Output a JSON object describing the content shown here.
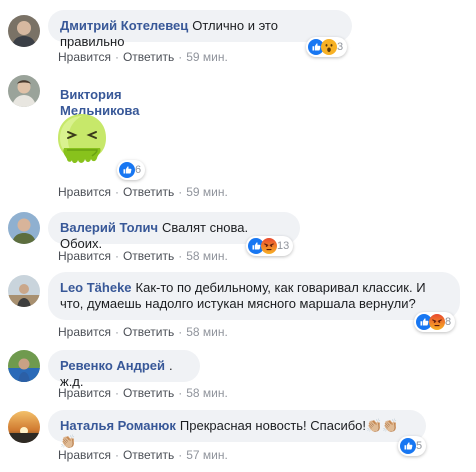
{
  "actions": {
    "like": "Нравится",
    "reply": "Ответить",
    "sep": "·"
  },
  "comments": [
    {
      "author": "Дмитрий Котелевец",
      "text": "Отлично и это правильно",
      "time": "59 мин.",
      "reactions": {
        "types": [
          "like",
          "wow"
        ],
        "count": "3"
      }
    },
    {
      "author": "Виктория Мельникова",
      "text": "",
      "sticker": "vomiting-green-blob-sticker",
      "time": "59 мин.",
      "reactions": {
        "types": [
          "like"
        ],
        "count": "6"
      }
    },
    {
      "author": "Валерий Толич",
      "text": "Свалят снова. Обоих.",
      "time": "58 мин.",
      "reactions": {
        "types": [
          "like",
          "angry"
        ],
        "count": "13"
      }
    },
    {
      "author": "Leo Täheke",
      "text": "Как-то по дебильному, как говаривал классик. И что, думаешь надолго истукан мясного маршала вернули?",
      "time": "58 мин.",
      "reactions": {
        "types": [
          "like",
          "angry"
        ],
        "count": "8"
      }
    },
    {
      "author": "Ревенко Андрей",
      "text": ". ж.д.",
      "time": "58 мин.",
      "reactions": null
    },
    {
      "author": "Наталья Романюк",
      "text": "Прекрасная новость! Спасибо!",
      "emojis": "👏🏼👏🏼👏🏼",
      "time": "57 мин.",
      "reactions": {
        "types": [
          "like"
        ],
        "count": "5"
      }
    }
  ]
}
